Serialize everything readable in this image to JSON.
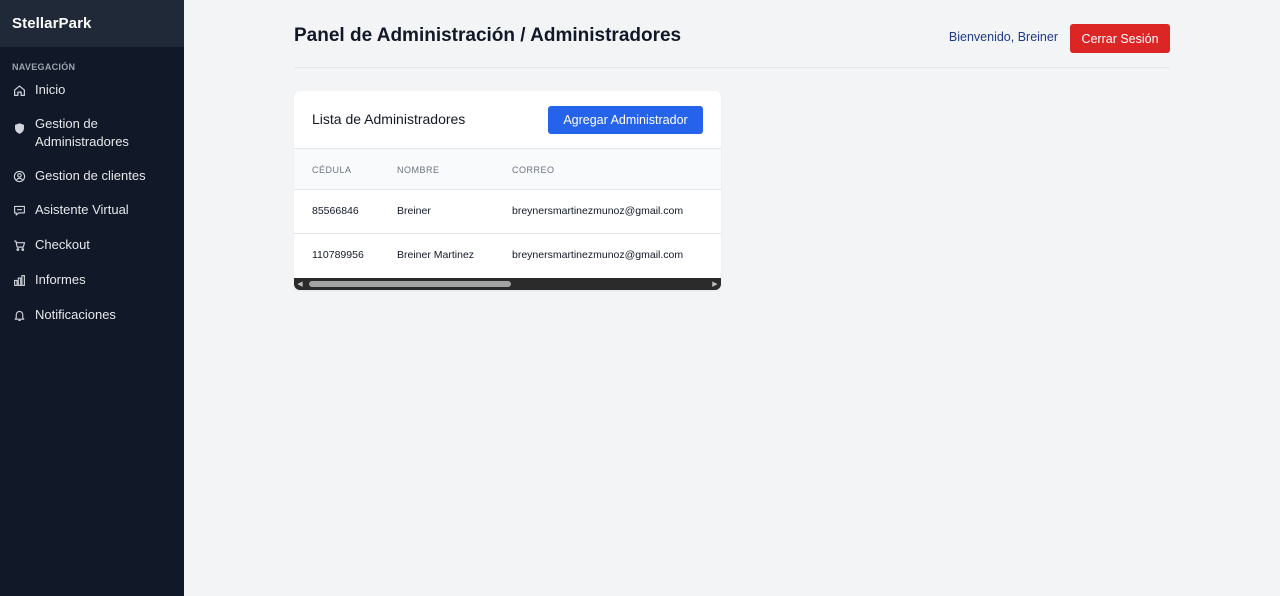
{
  "app": {
    "brand": "StellarPark"
  },
  "sidebar": {
    "heading": "NAVEGACIÓN",
    "items": [
      {
        "label": "Inicio",
        "icon": "home-icon"
      },
      {
        "label": "Gestion de Administradores",
        "icon": "shield-icon"
      },
      {
        "label": "Gestion de clientes",
        "icon": "user-circle-icon"
      },
      {
        "label": "Asistente Virtual",
        "icon": "chat-icon"
      },
      {
        "label": "Checkout",
        "icon": "cart-icon"
      },
      {
        "label": "Informes",
        "icon": "bar-chart-icon"
      },
      {
        "label": "Notificaciones",
        "icon": "bell-icon"
      }
    ]
  },
  "header": {
    "title": "Panel de Administración / Administradores",
    "welcome": "Bienvenido, Breiner",
    "logout_label": "Cerrar Sesión"
  },
  "card": {
    "title": "Lista de Administradores",
    "add_label": "Agregar Administrador",
    "columns": [
      "CÉDULA",
      "NOMBRE",
      "CORREO"
    ],
    "rows": [
      {
        "cedula": "85566846",
        "nombre": "Breiner",
        "correo": "breynersmartinezmunoz@gmail.com"
      },
      {
        "cedula": "110789956",
        "nombre": "Breiner Martinez",
        "correo": "breynersmartinezmunoz@gmail.com"
      }
    ]
  },
  "colors": {
    "sidebar_bg": "#111827",
    "brand_bg": "#1f2937",
    "primary": "#2563eb",
    "danger": "#dc2626",
    "page_bg": "#f3f4f6"
  }
}
